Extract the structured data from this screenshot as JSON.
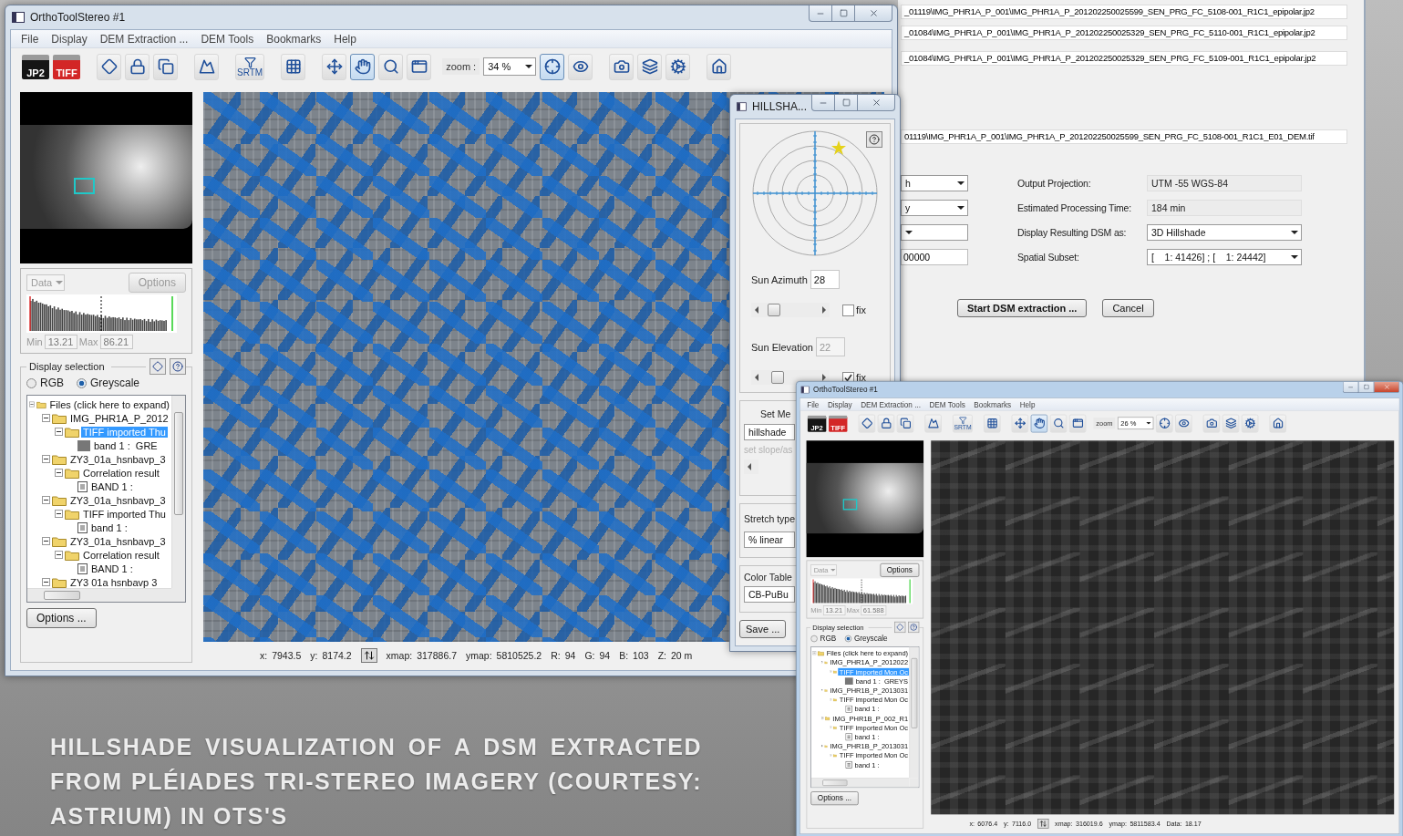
{
  "caption": "HILLSHADE VISUALIZATION OF A DSM EXTRACTED FROM PLÉIADES TRI-STEREO IMAGERY (COURTESY: ASTRIUM) IN OTS'S",
  "dem_dialog": {
    "paths": [
      "_01119\\IMG_PHR1A_P_001\\IMG_PHR1A_P_201202250025599_SEN_PRG_FC_5108-001_R1C1_epipolar.jp2",
      "_01084\\IMG_PHR1A_P_001\\IMG_PHR1A_P_201202250025329_SEN_PRG_FC_5110-001_R1C1_epipolar.jp2",
      "_01084\\IMG_PHR1A_P_001\\IMG_PHR1A_P_201202250025329_SEN_PRG_FC_5109-001_R1C1_epipolar.jp2",
      "01119\\IMG_PHR1A_P_001\\IMG_PHR1A_P_201202250025599_SEN_PRG_FC_5108-001_R1C1_E01_DEM.tif"
    ],
    "rows": [
      {
        "field": {
          "kind": "dropdown",
          "value": "h"
        },
        "label": "Output Projection:",
        "setting": {
          "kind": "readonly",
          "value": "UTM -55 WGS-84"
        }
      },
      {
        "field": {
          "kind": "dropdown",
          "value": "y"
        },
        "label": "Estimated Processing Time:",
        "setting": {
          "kind": "readonly",
          "value": "184 min"
        }
      },
      {
        "field": {
          "kind": "dropdown"
        },
        "label": "Display Resulting DSM as:",
        "setting": {
          "kind": "dropdown",
          "value": "3D Hillshade"
        }
      },
      {
        "field": {
          "kind": "text",
          "value": "00000"
        },
        "label": "Spatial Subset:",
        "setting": {
          "kind": "dropdown",
          "value": "[    1: 41426] ; [    1: 24442]"
        }
      }
    ],
    "buttons": [
      {
        "label": "Start DSM extraction ...",
        "default": true
      },
      {
        "label": "Cancel",
        "default": false
      }
    ]
  },
  "main_window": {
    "title": "OrthoToolStereo #1",
    "active": false,
    "menu": [
      "File",
      "Display",
      "DEM Extraction ...",
      "DEM Tools",
      "Bookmarks",
      "Help"
    ],
    "toolbar": {
      "tools": [
        {
          "label": "JP2",
          "selected": false
        },
        {
          "label": "TIFF",
          "selected": false
        },
        {
          "selected": false
        },
        {
          "selected": false
        },
        {
          "selected": false
        },
        {
          "selected": false
        },
        {
          "label": "SRTM",
          "selected": false
        },
        {
          "selected": false
        },
        {
          "selected": false
        },
        {
          "selected": true
        },
        {
          "selected": false
        },
        {
          "selected": false
        },
        {
          "selected": true
        },
        {
          "selected": false
        },
        {
          "selected": false
        },
        {
          "selected": false
        },
        {
          "selected": false
        },
        {
          "selected": false
        }
      ],
      "zoom_label": "zoom :",
      "zoom_value": "34 %"
    },
    "histogram": {
      "channel": "Data",
      "options": "Options",
      "disabled": true,
      "min_label": "Min",
      "min": "13.21",
      "max_label": "Max",
      "max": "86.21"
    },
    "display_selection": {
      "title": "Display selection",
      "modes": [
        {
          "label": "RGB",
          "selected": false
        },
        {
          "label": "Greyscale",
          "selected": true
        }
      ],
      "tree": [
        {
          "label": "Files (click here to expand)",
          "kind": "folder",
          "expanded": true,
          "selected": false,
          "children": [
            {
              "label": "IMG_PHR1A_P_2012",
              "kind": "folder",
              "expanded": true,
              "selected": false,
              "children": [
                {
                  "label": "TIFF imported Thu",
                  "kind": "folder",
                  "expanded": true,
                  "selected": true,
                  "children": [
                    {
                      "label": "band 1 :  GRE",
                      "kind": "raster",
                      "selected": false
                    }
                  ]
                }
              ]
            },
            {
              "label": "ZY3_01a_hsnbavp_3",
              "kind": "folder",
              "expanded": true,
              "selected": false,
              "children": [
                {
                  "label": "Correlation result",
                  "kind": "folder",
                  "expanded": true,
                  "selected": false,
                  "children": [
                    {
                      "label": "BAND 1 :",
                      "kind": "document",
                      "selected": false
                    }
                  ]
                }
              ]
            },
            {
              "label": "ZY3_01a_hsnbavp_3",
              "kind": "folder",
              "expanded": true,
              "selected": false,
              "children": [
                {
                  "label": "TIFF imported Thu",
                  "kind": "folder",
                  "expanded": true,
                  "selected": false,
                  "children": [
                    {
                      "label": "band 1 :",
                      "kind": "document",
                      "selected": false
                    }
                  ]
                }
              ]
            },
            {
              "label": "ZY3_01a_hsnbavp_3",
              "kind": "folder",
              "expanded": true,
              "selected": false,
              "children": [
                {
                  "label": "Correlation result",
                  "kind": "folder",
                  "expanded": true,
                  "selected": false,
                  "children": [
                    {
                      "label": "BAND 1 :",
                      "kind": "document",
                      "selected": false
                    }
                  ]
                }
              ]
            },
            {
              "label": "ZY3 01a hsnbavp 3",
              "kind": "folder",
              "expanded": true,
              "selected": false
            }
          ]
        }
      ],
      "options_button": "Options ..."
    },
    "view": {
      "kind": "hillshade"
    },
    "status": [
      {
        "label": "x:",
        "value": "7943.5"
      },
      {
        "label": "y:",
        "value": "8174.2"
      },
      {
        "label": "xmap:",
        "value": "317886.7"
      },
      {
        "label": "ymap:",
        "value": "5810525.2"
      },
      {
        "label": "R:",
        "value": "94"
      },
      {
        "label": "G:",
        "value": "94"
      },
      {
        "label": "B:",
        "value": "103"
      },
      {
        "label": "Z:",
        "value": "20 m"
      }
    ]
  },
  "hillshade_dialog": {
    "title": "HILLSHA...",
    "sun": [
      {
        "label": "Sun Azimuth",
        "value": "28",
        "disabled": false,
        "level": 0.12,
        "fix_label": "fix",
        "fix": false
      },
      {
        "label": "Sun Elevation",
        "value": "22",
        "disabled": true,
        "level": 0.2,
        "fix_label": "fix",
        "fix": true
      }
    ],
    "method": {
      "title": "Set Me",
      "value": "hillshade",
      "slope_label": "set slope/as"
    },
    "stretch": {
      "title": "Stretch type",
      "value": "% linear"
    },
    "color_table": {
      "title": "Color Table",
      "value": "CB-PuBu"
    },
    "save": "Save ..."
  },
  "second_window": {
    "title": "OrthoToolStereo #1",
    "active": true,
    "menu": [
      "File",
      "Display",
      "DEM Extraction ...",
      "DEM Tools",
      "Bookmarks",
      "Help"
    ],
    "toolbar": {
      "tools": [
        {
          "label": "JP2",
          "selected": false
        },
        {
          "label": "TIFF",
          "selected": false
        },
        {
          "selected": false
        },
        {
          "selected": false
        },
        {
          "selected": false
        },
        {
          "selected": false
        },
        {
          "label": "SRTM",
          "selected": false
        },
        {
          "selected": false
        },
        {
          "selected": false
        },
        {
          "selected": true
        },
        {
          "selected": false
        },
        {
          "selected": false
        },
        {
          "selected": false
        },
        {
          "selected": false
        },
        {
          "selected": false
        },
        {
          "selected": false
        },
        {
          "selected": false
        },
        {
          "selected": false
        }
      ],
      "zoom_label": "zoom",
      "zoom_value": "26 %"
    },
    "histogram": {
      "channel": "Data",
      "options": "Options",
      "disabled": false,
      "min_label": "Min",
      "min": "13.21",
      "max_label": "Max",
      "max": "61.588"
    },
    "display_selection": {
      "title": "Display selection",
      "modes": [
        {
          "label": "RGB",
          "selected": false
        },
        {
          "label": "Greyscale",
          "selected": true
        }
      ],
      "tree": [
        {
          "label": "Files (click here to expand)",
          "kind": "folder",
          "expanded": true,
          "selected": false,
          "children": [
            {
              "label": "IMG_PHR1A_P_2012022",
              "kind": "folder",
              "expanded": true,
              "selected": false,
              "children": [
                {
                  "label": "TIFF imported Mon Oc",
                  "kind": "folder",
                  "expanded": true,
                  "selected": true,
                  "children": [
                    {
                      "label": "band 1 :  GREYS",
                      "kind": "raster",
                      "selected": false
                    }
                  ]
                }
              ]
            },
            {
              "label": "IMG_PHR1B_P_2013031",
              "kind": "folder",
              "expanded": true,
              "selected": false,
              "children": [
                {
                  "label": "TIFF imported Mon Oc",
                  "kind": "folder",
                  "expanded": true,
                  "selected": false,
                  "children": [
                    {
                      "label": "band 1 :",
                      "kind": "document",
                      "selected": false
                    }
                  ]
                }
              ]
            },
            {
              "label": "IMG_PHR1B_P_002_R1",
              "kind": "folder",
              "expanded": true,
              "selected": false,
              "children": [
                {
                  "label": "TIFF imported Mon Oc",
                  "kind": "folder",
                  "expanded": true,
                  "selected": false,
                  "children": [
                    {
                      "label": "band 1 :",
                      "kind": "document",
                      "selected": false
                    }
                  ]
                }
              ]
            },
            {
              "label": "IMG_PHR1B_P_2013031",
              "kind": "folder",
              "expanded": true,
              "selected": false,
              "children": [
                {
                  "label": "TIFF imported Mon Oc",
                  "kind": "folder",
                  "expanded": true,
                  "selected": false,
                  "children": [
                    {
                      "label": "band 1 :",
                      "kind": "document",
                      "selected": false
                    }
                  ]
                }
              ]
            }
          ]
        }
      ],
      "options_button": "Options ..."
    },
    "view": {
      "kind": "greyscale"
    },
    "status": [
      {
        "label": "x:",
        "value": "6076.4"
      },
      {
        "label": "y:",
        "value": "7116.0"
      },
      {
        "label": "xmap:",
        "value": "316019.6"
      },
      {
        "label": "ymap:",
        "value": "5811583.4"
      },
      {
        "label": "Data:",
        "value": "18.17"
      }
    ]
  }
}
